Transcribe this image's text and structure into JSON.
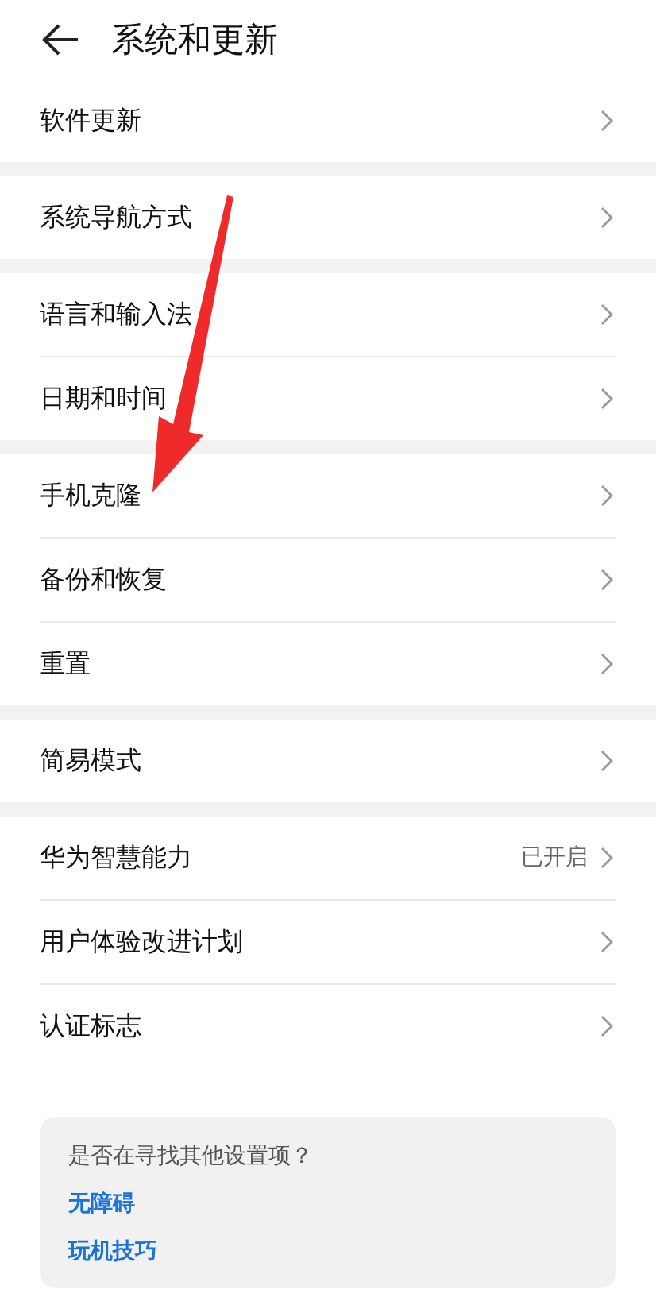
{
  "header": {
    "title": "系统和更新"
  },
  "groups": [
    {
      "items": [
        {
          "label": "软件更新"
        }
      ]
    },
    {
      "items": [
        {
          "label": "系统导航方式"
        }
      ]
    },
    {
      "items": [
        {
          "label": "语言和输入法"
        },
        {
          "label": "日期和时间"
        }
      ]
    },
    {
      "items": [
        {
          "label": "手机克隆"
        },
        {
          "label": "备份和恢复"
        },
        {
          "label": "重置"
        }
      ]
    },
    {
      "items": [
        {
          "label": "简易模式"
        }
      ]
    },
    {
      "items": [
        {
          "label": "华为智慧能力",
          "value": "已开启"
        },
        {
          "label": "用户体验改进计划"
        },
        {
          "label": "认证标志"
        }
      ]
    }
  ],
  "suggestions": {
    "question": "是否在寻找其他设置项？",
    "links": [
      "无障碍",
      "玩机技巧"
    ]
  }
}
